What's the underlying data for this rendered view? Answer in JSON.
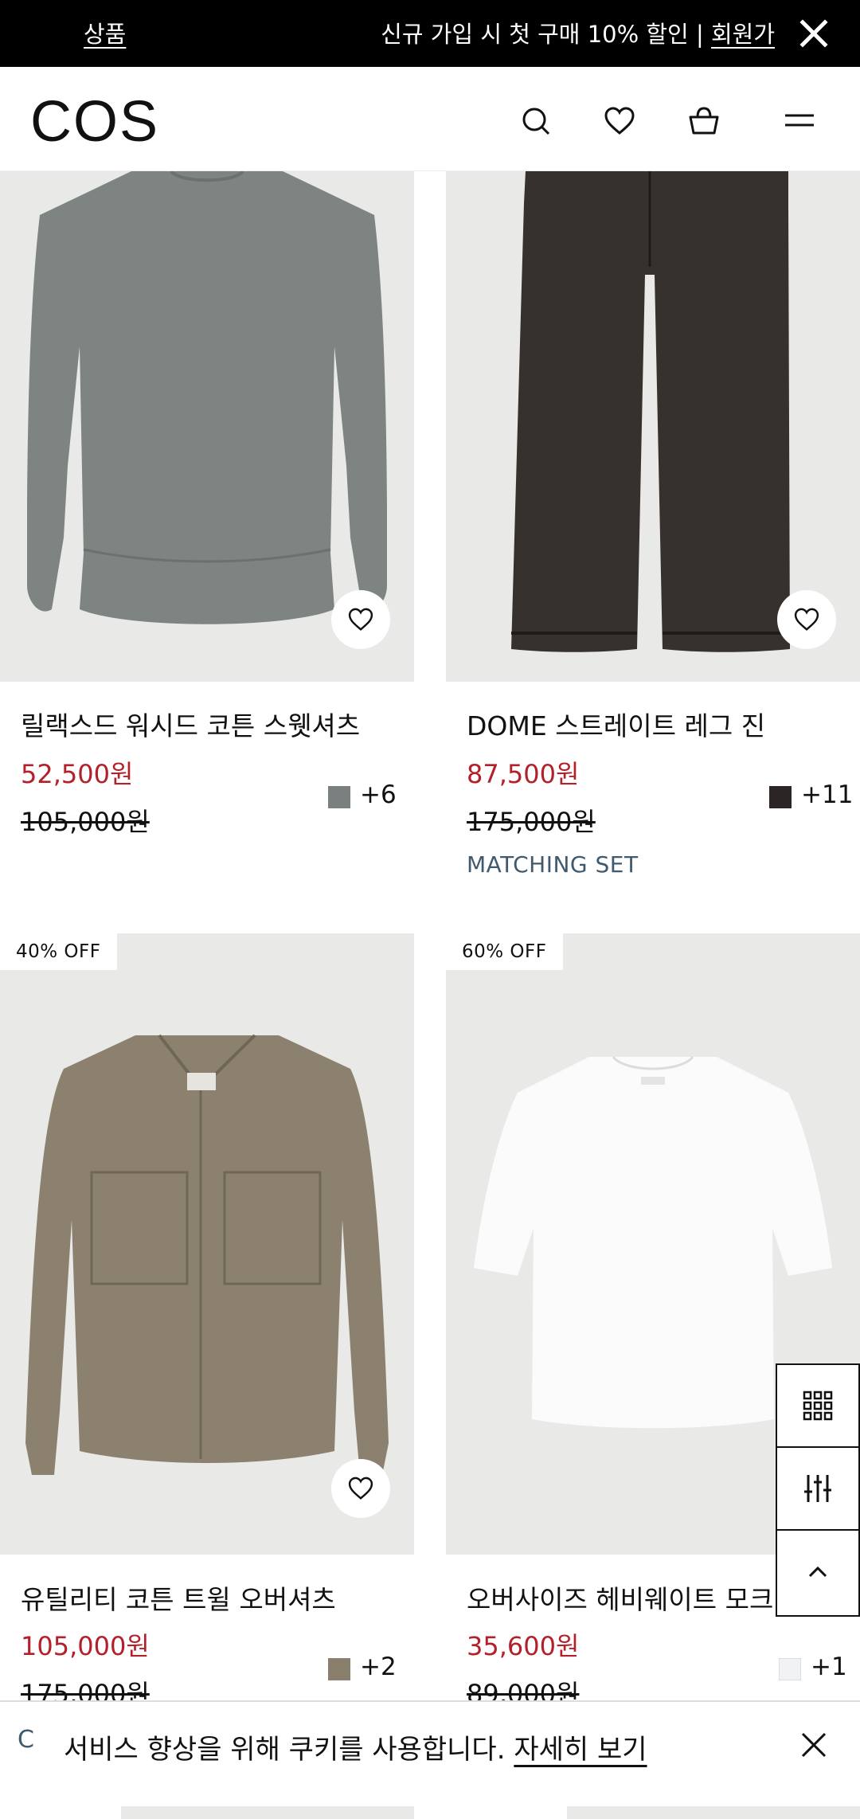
{
  "promo": {
    "left_link": "상품",
    "message": "신규 가입 시 첫 구매 10% 할인 | ",
    "member_link": "회원가"
  },
  "header": {
    "logo": "COS",
    "icons": [
      "search-icon",
      "heart-icon",
      "bag-icon",
      "menu-icon"
    ]
  },
  "products": [
    {
      "name": "릴랙스드 워시드 코튼 스웻셔츠",
      "price": "52,500원",
      "old_price": "105,000원",
      "swatch_color": "#7a7f80",
      "more_colors": "+6"
    },
    {
      "name": "DOME 스트레이트 레그 진",
      "price": "87,500원",
      "old_price": "175,000원",
      "swatch_color": "#2b2525",
      "more_colors": "+11",
      "tag": "MATCHING SET"
    },
    {
      "badge": "40% OFF",
      "name": "유틸리티 코튼 트윌 오버셔츠",
      "price": "105,000원",
      "old_price": "175,000원",
      "swatch_color": "#8a7f6c",
      "more_colors": "+2"
    },
    {
      "badge": "60% OFF",
      "name": "오버사이즈 헤비웨이트 모크",
      "price": "35,600원",
      "old_price": "89,000원",
      "swatch_color": "#f1f2f6",
      "more_colors": "+1"
    }
  ],
  "tools": [
    "grid-view-icon",
    "filter-icon",
    "scroll-top-icon"
  ],
  "cookie": {
    "edge_text": "C",
    "message": "서비스 향상을 위해 쿠키를 사용합니다. ",
    "more_link": "자세히 보기"
  },
  "colors": {
    "sale_red": "#b3202a",
    "tag_blue": "#3f5a6e",
    "image_bg": "#e9e9e7"
  }
}
